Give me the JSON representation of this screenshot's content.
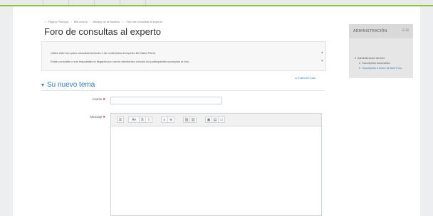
{
  "colors": {
    "accent": "#8cc63f",
    "link": "#2f7ab8",
    "required": "#d9534f"
  },
  "breadcrumb": [
    "Página Principal",
    "Mis cursos",
    "Manejo de la insulina",
    "Foro de consultas al experto"
  ],
  "page_title": "Foro de consultas al experto",
  "intro": {
    "line1": "Utilice este foro para consultas técnicas o de contenidos al experto Mr Mario Pierre.",
    "line2": "Estas consultas o sus respuestas le llegarán por correo electrónico a todos los participantes suscriptos al foro.",
    "scroll_up_icon": "arrow-up-icon",
    "scroll_down_icon": "arrow-down-icon"
  },
  "expand_all": "Extender todo",
  "section_title": "Su nuevo tema",
  "fields": {
    "subject_label": "Asunto",
    "message_label": "Mensaje",
    "required_mark": "●",
    "subject_value": ""
  },
  "editor": {
    "toolbar_icons": [
      "toolbar-toggle-icon",
      "font-style-icon",
      "bold-icon",
      "italic-icon",
      "unordered-list-icon",
      "ordered-list-icon",
      "link-icon",
      "unlink-icon",
      "image-icon",
      "media-icon",
      "file-icon"
    ],
    "toolbar_glyphs": [
      "☰",
      "A▾",
      "B",
      "I",
      "≡",
      "≣",
      "⛓",
      "⛓",
      "▣",
      "▤",
      "▭"
    ]
  },
  "sidebar": {
    "title": "ADMINISTRACIÓN",
    "header_icons": "⊟ ⊞",
    "items": [
      {
        "label": "Administración del foro"
      },
      {
        "label": "Suscripción automática"
      },
      {
        "label": "Suscripción a lector de feed Foro"
      }
    ]
  }
}
